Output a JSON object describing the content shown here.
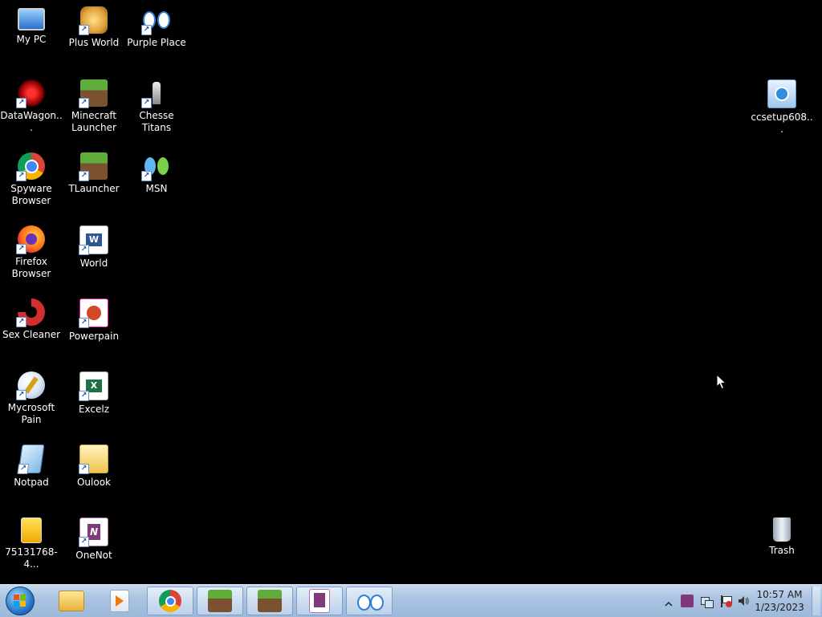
{
  "desktop": {
    "icons": [
      {
        "label": "My PC",
        "icon": "computer-icon"
      },
      {
        "label": "Plus World",
        "icon": "plus-world-icon"
      },
      {
        "label": "Purple Place",
        "icon": "purple-place-icon"
      },
      {
        "label": "DataWagon...",
        "icon": "datawagon-icon"
      },
      {
        "label": "Minecraft Launcher",
        "icon": "minecraft-icon"
      },
      {
        "label": "Chesse Titans",
        "icon": "chess-icon"
      },
      {
        "label": "Spyware Browser",
        "icon": "chrome-icon"
      },
      {
        "label": "TLauncher",
        "icon": "minecraft-icon"
      },
      {
        "label": "MSN",
        "icon": "msn-icon"
      },
      {
        "label": "Firefox Browser",
        "icon": "firefox-icon"
      },
      {
        "label": "World",
        "icon": "word-icon"
      },
      {
        "label": "Sex Cleaner",
        "icon": "ccleaner-icon"
      },
      {
        "label": "Powerpain",
        "icon": "powerpoint-icon"
      },
      {
        "label": "Mycrosoft Pain",
        "icon": "paint-icon"
      },
      {
        "label": "Excelz",
        "icon": "excel-icon"
      },
      {
        "label": "Notpad",
        "icon": "notepad-icon"
      },
      {
        "label": "Oulook",
        "icon": "outlook-icon"
      },
      {
        "label": "75131768-4...",
        "icon": "image-file-icon"
      },
      {
        "label": "OneNot",
        "icon": "onenote-icon"
      },
      {
        "label": "ccsetup608...",
        "icon": "installer-icon"
      },
      {
        "label": "Trash",
        "icon": "recycle-bin-icon"
      }
    ]
  },
  "taskbar": {
    "start_icon": "windows-start-icon",
    "pinned": [
      {
        "icon": "file-explorer-icon"
      },
      {
        "icon": "media-player-icon"
      },
      {
        "icon": "chrome-icon"
      },
      {
        "icon": "minecraft-icon"
      },
      {
        "icon": "minecraft-icon"
      },
      {
        "icon": "onenote-icon"
      },
      {
        "icon": "eyes-icon"
      }
    ],
    "tray": {
      "time": "10:57 AM",
      "date": "1/23/2023"
    }
  }
}
